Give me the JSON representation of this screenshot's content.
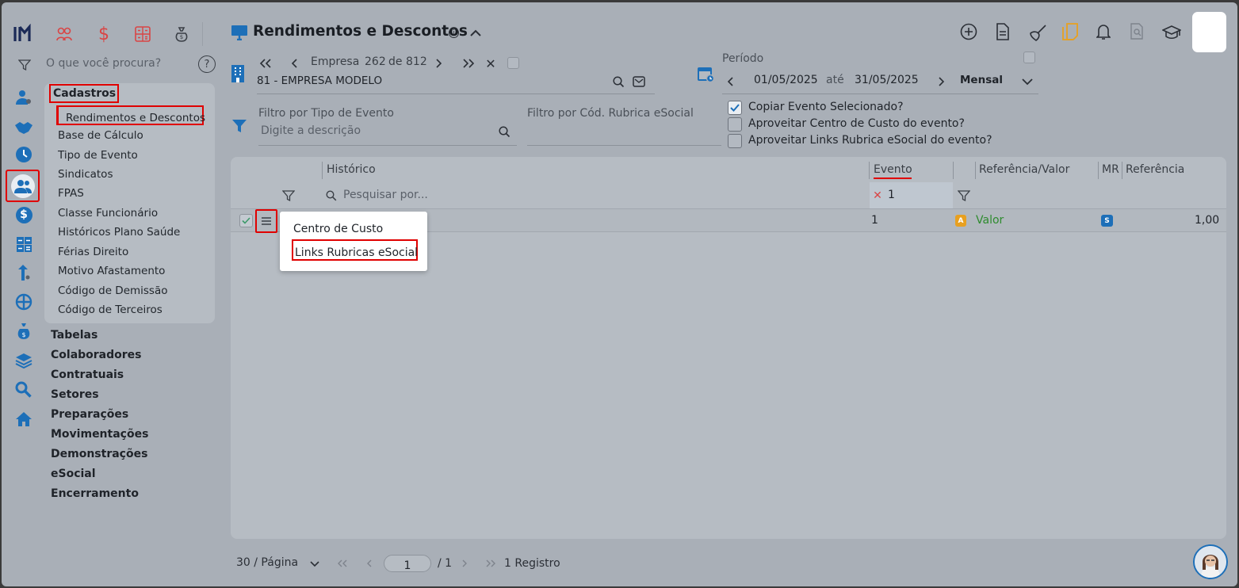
{
  "app": {
    "title": "Rendimentos e Descontos"
  },
  "top_icons": [
    "people-icon",
    "dollar-icon",
    "calculator-icon",
    "money-bag-icon"
  ],
  "search": {
    "placeholder": "O que você procura?"
  },
  "menu": {
    "section": "Cadastros",
    "items": [
      "Rendimentos e Descontos",
      "Base de Cálculo",
      "Tipo de Evento",
      "Sindicatos",
      "FPAS",
      "Classe Funcionário",
      "Históricos Plano Saúde",
      "Férias Direito",
      "Motivo Afastamento",
      "Código de Demissão",
      "Código de Terceiros"
    ],
    "groups": [
      "Tabelas",
      "Colaboradores",
      "Contratuais",
      "Setores",
      "Preparações",
      "Movimentações",
      "Demonstrações",
      "eSocial",
      "Encerramento"
    ]
  },
  "empresa": {
    "label": "Empresa",
    "current": "262",
    "de": "de",
    "total": "812",
    "name": "81 - EMPRESA MODELO"
  },
  "periodo": {
    "label": "Período",
    "start": "01/05/2025",
    "ate": "até",
    "end": "31/05/2025",
    "type": "Mensal"
  },
  "filters": {
    "tipo_evento_label": "Filtro por Tipo de Evento",
    "tipo_evento_placeholder": "Digite a descrição",
    "rubrica_label": "Filtro por Cód. Rubrica eSocial"
  },
  "options": [
    {
      "label": "Copiar Evento Selecionado?",
      "checked": true
    },
    {
      "label": "Aproveitar Centro de Custo do evento?",
      "checked": false
    },
    {
      "label": "Aproveitar Links Rubrica eSocial do evento?",
      "checked": false
    }
  ],
  "table": {
    "headers": {
      "historico": "Histórico",
      "evento": "Evento",
      "ref_valor": "Referência/Valor",
      "mr": "MR",
      "referencia": "Referência"
    },
    "search_placeholder": "Pesquisar por...",
    "evento_filter": "1",
    "row": {
      "evento": "1",
      "badge": "A",
      "tipo": "Valor",
      "mr_badge": "S",
      "referencia": "1,00"
    }
  },
  "context_menu": {
    "items": [
      "Centro de Custo",
      "Links Rubricas eSocial"
    ]
  },
  "pagination": {
    "per_page": "30 / Página",
    "page": "1",
    "of": "/ 1",
    "records": "1 Registro"
  },
  "colors": {
    "accent": "#1d6fb8",
    "brand": "#1b2a57",
    "highlight": "#e00000",
    "valor_green": "#2e8b2e"
  }
}
